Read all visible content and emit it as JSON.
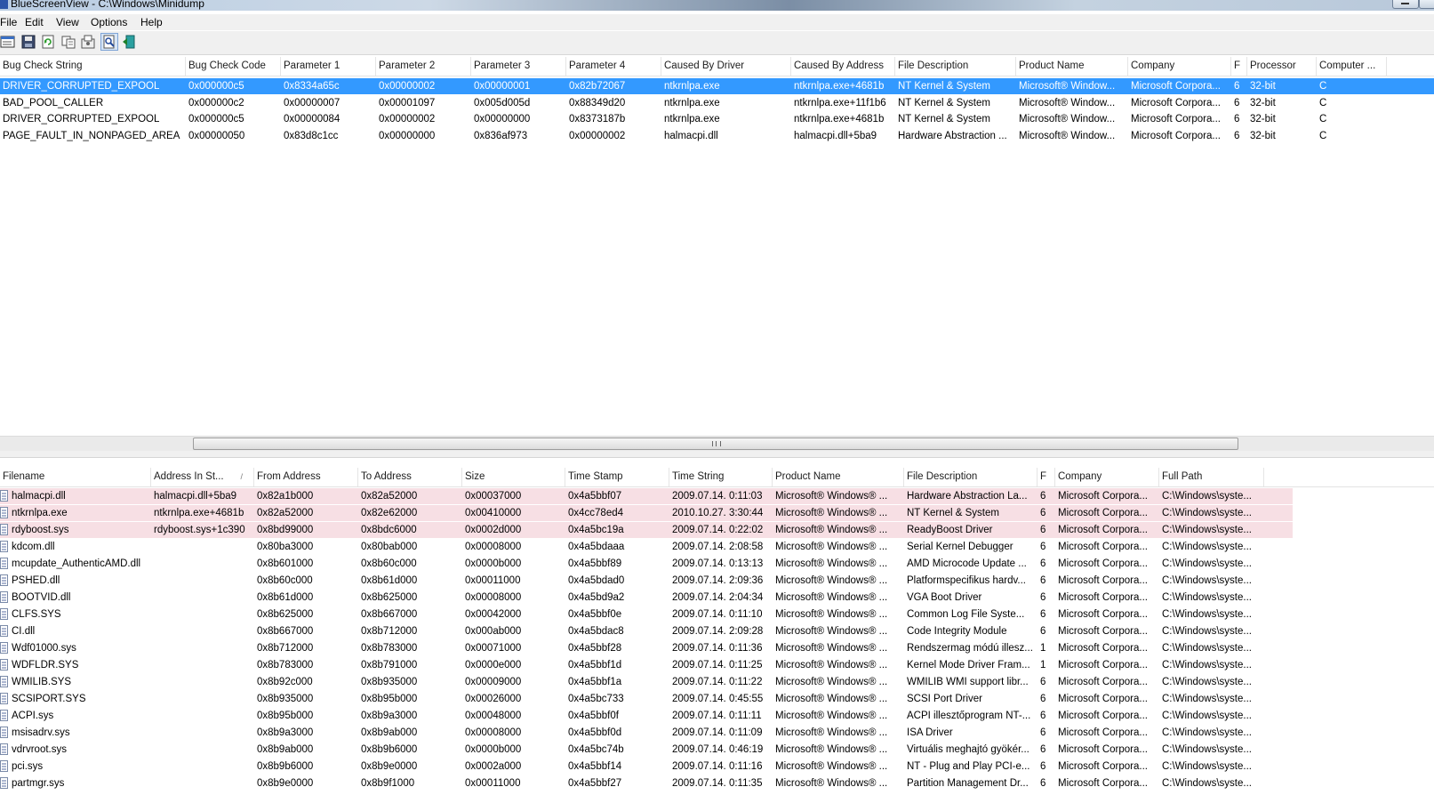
{
  "window": {
    "title": "BlueScreenView  -  C:\\Windows\\Minidump"
  },
  "menu": [
    "File",
    "Edit",
    "View",
    "Options",
    "Help"
  ],
  "toolbar": [
    {
      "name": "properties-icon"
    },
    {
      "name": "save-icon"
    },
    {
      "name": "refresh-icon"
    },
    {
      "name": "copy-icon"
    },
    {
      "name": "advanced-options-icon"
    },
    {
      "name": "find-icon"
    },
    {
      "name": "exit-icon"
    }
  ],
  "crash_table": {
    "columns": [
      "Bug Check String",
      "Bug Check Code",
      "Parameter 1",
      "Parameter 2",
      "Parameter 3",
      "Parameter 4",
      "Caused By Driver",
      "Caused By Address",
      "File Description",
      "Product Name",
      "Company",
      "F",
      "Processor",
      "Computer ..."
    ],
    "rows": [
      {
        "selected": true,
        "cells": [
          "DRIVER_CORRUPTED_EXPOOL",
          "0x000000c5",
          "0x8334a65c",
          "0x00000002",
          "0x00000001",
          "0x82b72067",
          "ntkrnlpa.exe",
          "ntkrnlpa.exe+4681b",
          "NT Kernel & System",
          "Microsoft® Window...",
          "Microsoft Corpora...",
          "6",
          "32-bit",
          "C"
        ]
      },
      {
        "selected": false,
        "cells": [
          "BAD_POOL_CALLER",
          "0x000000c2",
          "0x00000007",
          "0x00001097",
          "0x005d005d",
          "0x88349d20",
          "ntkrnlpa.exe",
          "ntkrnlpa.exe+11f1b6",
          "NT Kernel & System",
          "Microsoft® Window...",
          "Microsoft Corpora...",
          "6",
          "32-bit",
          "C"
        ]
      },
      {
        "selected": false,
        "cells": [
          "DRIVER_CORRUPTED_EXPOOL",
          "0x000000c5",
          "0x00000084",
          "0x00000002",
          "0x00000000",
          "0x8373187b",
          "ntkrnlpa.exe",
          "ntkrnlpa.exe+4681b",
          "NT Kernel & System",
          "Microsoft® Window...",
          "Microsoft Corpora...",
          "6",
          "32-bit",
          "C"
        ]
      },
      {
        "selected": false,
        "cells": [
          "PAGE_FAULT_IN_NONPAGED_AREA",
          "0x00000050",
          "0x83d8c1cc",
          "0x00000000",
          "0x836af973",
          "0x00000002",
          "halmacpi.dll",
          "halmacpi.dll+5ba9",
          "Hardware Abstraction ...",
          "Microsoft® Window...",
          "Microsoft Corpora...",
          "6",
          "32-bit",
          "C"
        ]
      }
    ]
  },
  "driver_table": {
    "columns": [
      "Filename",
      "Address In St...",
      "From Address",
      "To Address",
      "Size",
      "Time Stamp",
      "Time String",
      "Product Name",
      "File Description",
      "F",
      "Company",
      "Full Path"
    ],
    "rows": [
      {
        "highlight": true,
        "cells": [
          "halmacpi.dll",
          "halmacpi.dll+5ba9",
          "0x82a1b000",
          "0x82a52000",
          "0x00037000",
          "0x4a5bbf07",
          "2009.07.14. 0:11:03",
          "Microsoft® Windows® ...",
          "Hardware Abstraction La...",
          "6",
          "Microsoft Corpora...",
          "C:\\Windows\\syste..."
        ]
      },
      {
        "highlight": true,
        "cells": [
          "ntkrnlpa.exe",
          "ntkrnlpa.exe+4681b",
          "0x82a52000",
          "0x82e62000",
          "0x00410000",
          "0x4cc78ed4",
          "2010.10.27. 3:30:44",
          "Microsoft® Windows® ...",
          "NT Kernel & System",
          "6",
          "Microsoft Corpora...",
          "C:\\Windows\\syste..."
        ]
      },
      {
        "highlight": true,
        "cells": [
          "rdyboost.sys",
          "rdyboost.sys+1c390",
          "0x8bd99000",
          "0x8bdc6000",
          "0x0002d000",
          "0x4a5bc19a",
          "2009.07.14. 0:22:02",
          "Microsoft® Windows® ...",
          "ReadyBoost Driver",
          "6",
          "Microsoft Corpora...",
          "C:\\Windows\\syste..."
        ]
      },
      {
        "highlight": false,
        "cells": [
          "kdcom.dll",
          "",
          "0x80ba3000",
          "0x80bab000",
          "0x00008000",
          "0x4a5bdaaa",
          "2009.07.14. 2:08:58",
          "Microsoft® Windows® ...",
          "Serial Kernel Debugger",
          "6",
          "Microsoft Corpora...",
          "C:\\Windows\\syste..."
        ]
      },
      {
        "highlight": false,
        "cells": [
          "mcupdate_AuthenticAMD.dll",
          "",
          "0x8b601000",
          "0x8b60c000",
          "0x0000b000",
          "0x4a5bbf89",
          "2009.07.14. 0:13:13",
          "Microsoft® Windows® ...",
          "AMD Microcode Update ...",
          "6",
          "Microsoft Corpora...",
          "C:\\Windows\\syste..."
        ]
      },
      {
        "highlight": false,
        "cells": [
          "PSHED.dll",
          "",
          "0x8b60c000",
          "0x8b61d000",
          "0x00011000",
          "0x4a5bdad0",
          "2009.07.14. 2:09:36",
          "Microsoft® Windows® ...",
          "Platformspecifikus hardv...",
          "6",
          "Microsoft Corpora...",
          "C:\\Windows\\syste..."
        ]
      },
      {
        "highlight": false,
        "cells": [
          "BOOTVID.dll",
          "",
          "0x8b61d000",
          "0x8b625000",
          "0x00008000",
          "0x4a5bd9a2",
          "2009.07.14. 2:04:34",
          "Microsoft® Windows® ...",
          "VGA Boot Driver",
          "6",
          "Microsoft Corpora...",
          "C:\\Windows\\syste..."
        ]
      },
      {
        "highlight": false,
        "cells": [
          "CLFS.SYS",
          "",
          "0x8b625000",
          "0x8b667000",
          "0x00042000",
          "0x4a5bbf0e",
          "2009.07.14. 0:11:10",
          "Microsoft® Windows® ...",
          "Common Log File Syste...",
          "6",
          "Microsoft Corpora...",
          "C:\\Windows\\syste..."
        ]
      },
      {
        "highlight": false,
        "cells": [
          "CI.dll",
          "",
          "0x8b667000",
          "0x8b712000",
          "0x000ab000",
          "0x4a5bdac8",
          "2009.07.14. 2:09:28",
          "Microsoft® Windows® ...",
          "Code Integrity Module",
          "6",
          "Microsoft Corpora...",
          "C:\\Windows\\syste..."
        ]
      },
      {
        "highlight": false,
        "cells": [
          "Wdf01000.sys",
          "",
          "0x8b712000",
          "0x8b783000",
          "0x00071000",
          "0x4a5bbf28",
          "2009.07.14. 0:11:36",
          "Microsoft® Windows® ...",
          "Rendszermag módú illesz...",
          "1",
          "Microsoft Corpora...",
          "C:\\Windows\\syste..."
        ]
      },
      {
        "highlight": false,
        "cells": [
          "WDFLDR.SYS",
          "",
          "0x8b783000",
          "0x8b791000",
          "0x0000e000",
          "0x4a5bbf1d",
          "2009.07.14. 0:11:25",
          "Microsoft® Windows® ...",
          "Kernel Mode Driver Fram...",
          "1",
          "Microsoft Corpora...",
          "C:\\Windows\\syste..."
        ]
      },
      {
        "highlight": false,
        "cells": [
          "WMILIB.SYS",
          "",
          "0x8b92c000",
          "0x8b935000",
          "0x00009000",
          "0x4a5bbf1a",
          "2009.07.14. 0:11:22",
          "Microsoft® Windows® ...",
          "WMILIB WMI support libr...",
          "6",
          "Microsoft Corpora...",
          "C:\\Windows\\syste..."
        ]
      },
      {
        "highlight": false,
        "cells": [
          "SCSIPORT.SYS",
          "",
          "0x8b935000",
          "0x8b95b000",
          "0x00026000",
          "0x4a5bc733",
          "2009.07.14. 0:45:55",
          "Microsoft® Windows® ...",
          "SCSI Port Driver",
          "6",
          "Microsoft Corpora...",
          "C:\\Windows\\syste..."
        ]
      },
      {
        "highlight": false,
        "cells": [
          "ACPI.sys",
          "",
          "0x8b95b000",
          "0x8b9a3000",
          "0x00048000",
          "0x4a5bbf0f",
          "2009.07.14. 0:11:11",
          "Microsoft® Windows® ...",
          "ACPI illesztőprogram NT-...",
          "6",
          "Microsoft Corpora...",
          "C:\\Windows\\syste..."
        ]
      },
      {
        "highlight": false,
        "cells": [
          "msisadrv.sys",
          "",
          "0x8b9a3000",
          "0x8b9ab000",
          "0x00008000",
          "0x4a5bbf0d",
          "2009.07.14. 0:11:09",
          "Microsoft® Windows® ...",
          "ISA Driver",
          "6",
          "Microsoft Corpora...",
          "C:\\Windows\\syste..."
        ]
      },
      {
        "highlight": false,
        "cells": [
          "vdrvroot.sys",
          "",
          "0x8b9ab000",
          "0x8b9b6000",
          "0x0000b000",
          "0x4a5bc74b",
          "2009.07.14. 0:46:19",
          "Microsoft® Windows® ...",
          "Virtuális meghajtó gyökér...",
          "6",
          "Microsoft Corpora...",
          "C:\\Windows\\syste..."
        ]
      },
      {
        "highlight": false,
        "cells": [
          "pci.sys",
          "",
          "0x8b9b6000",
          "0x8b9e0000",
          "0x0002a000",
          "0x4a5bbf14",
          "2009.07.14. 0:11:16",
          "Microsoft® Windows® ...",
          "NT - Plug and Play PCI-e...",
          "6",
          "Microsoft Corpora...",
          "C:\\Windows\\syste..."
        ]
      },
      {
        "highlight": false,
        "cells": [
          "partmgr.sys",
          "",
          "0x8b9e0000",
          "0x8b9f1000",
          "0x00011000",
          "0x4a5bbf27",
          "2009.07.14. 0:11:35",
          "Microsoft® Windows® ...",
          "Partition Management Dr...",
          "6",
          "Microsoft Corpora...",
          "C:\\Windows\\syste..."
        ]
      }
    ]
  }
}
